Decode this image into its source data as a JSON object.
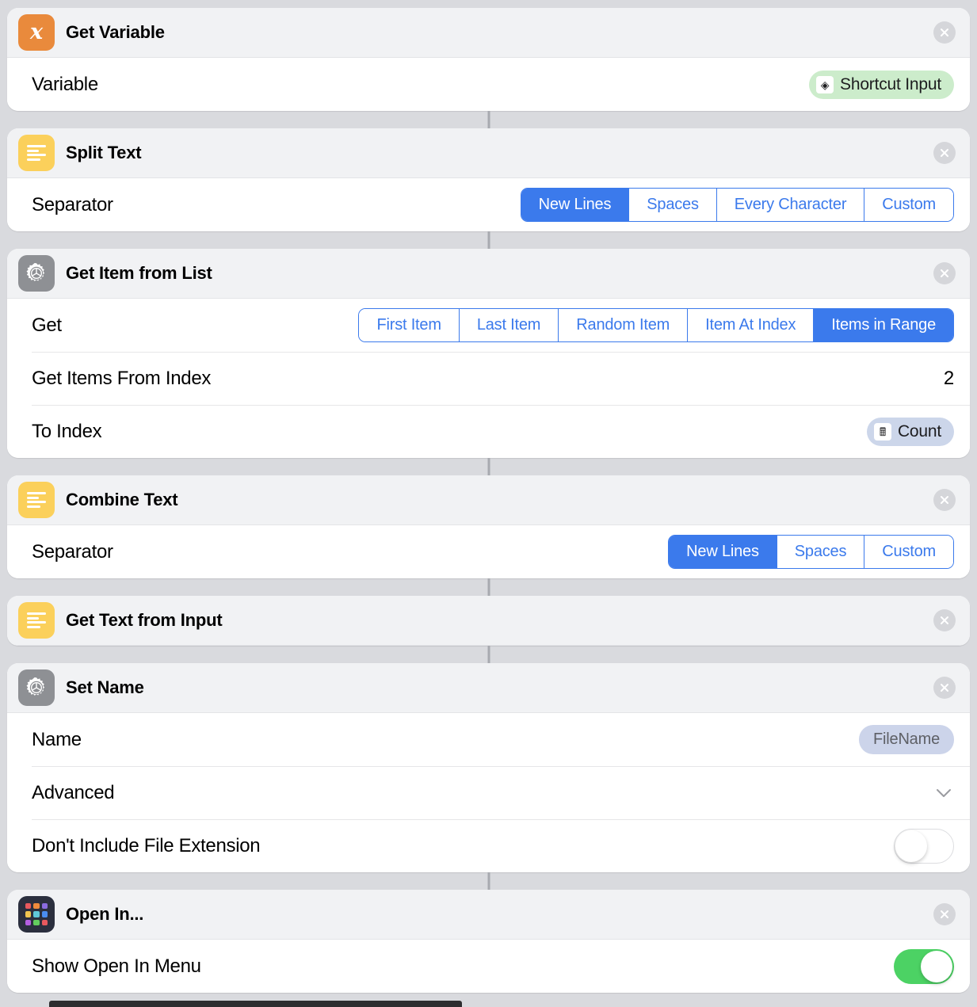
{
  "app": {
    "name": "Shortcuts Editor",
    "close_icon": "close-icon"
  },
  "colors": {
    "accent_blue": "#3b7aec",
    "icon_orange": "#e98a3c",
    "icon_yellow": "#fbd05b",
    "icon_gray": "#8e9094",
    "icon_grid_bg": "#2b2f3e",
    "toggle_on_green": "#4cd264",
    "token_green": "#cceccb",
    "token_blue": "#ccd6ea",
    "page_background": "#d9dade"
  },
  "actions": [
    {
      "id": "get-variable",
      "title": "Get Variable",
      "icon": "variable-x-icon",
      "icon_style": "orange",
      "rows": [
        {
          "type": "token",
          "label": "Variable",
          "token": {
            "text": "Shortcut Input",
            "style": "green",
            "icon": "shortcut-input-icon",
            "glyph": "◈"
          }
        }
      ]
    },
    {
      "id": "split-text",
      "title": "Split Text",
      "icon": "text-lines-icon",
      "icon_style": "yellow",
      "rows": [
        {
          "type": "segmented",
          "label": "Separator",
          "options": [
            "New Lines",
            "Spaces",
            "Every Character",
            "Custom"
          ],
          "selected": "New Lines"
        }
      ]
    },
    {
      "id": "get-item-from-list",
      "title": "Get Item from List",
      "icon": "gear-icon",
      "icon_style": "gray",
      "rows": [
        {
          "type": "segmented",
          "label": "Get",
          "options": [
            "First Item",
            "Last Item",
            "Random Item",
            "Item At Index",
            "Items in Range"
          ],
          "selected": "Items in Range"
        },
        {
          "type": "value",
          "label": "Get Items From Index",
          "value": "2"
        },
        {
          "type": "token",
          "label": "To Index",
          "token": {
            "text": "Count",
            "style": "blue",
            "icon": "calculator-icon",
            "glyph": "🖩"
          }
        }
      ]
    },
    {
      "id": "combine-text",
      "title": "Combine Text",
      "icon": "text-lines-icon",
      "icon_style": "yellow",
      "rows": [
        {
          "type": "segmented",
          "label": "Separator",
          "options": [
            "New Lines",
            "Spaces",
            "Custom"
          ],
          "selected": "New Lines"
        }
      ]
    },
    {
      "id": "get-text-from-input",
      "title": "Get Text from Input",
      "icon": "text-lines-icon",
      "icon_style": "yellow",
      "rows": []
    },
    {
      "id": "set-name",
      "title": "Set Name",
      "icon": "gear-icon",
      "icon_style": "gray",
      "rows": [
        {
          "type": "token",
          "label": "Name",
          "token": {
            "text": "FileName",
            "style": "plain"
          }
        },
        {
          "type": "disclosure",
          "label": "Advanced",
          "icon": "chevron-down-icon"
        },
        {
          "type": "toggle",
          "label": "Don't Include File Extension",
          "state": "off"
        }
      ]
    },
    {
      "id": "open-in",
      "title": "Open In...",
      "icon": "app-grid-icon",
      "icon_style": "grid",
      "rows": [
        {
          "type": "toggle",
          "label": "Show Open In Menu",
          "state": "on"
        }
      ]
    }
  ],
  "grid_icon_colors": [
    "#e8595e",
    "#ef8b3c",
    "#8b6ce0",
    "#f0c550",
    "#5fc9d8",
    "#4a8df0",
    "#b45fe0",
    "#63cc5e",
    "#e8595e"
  ]
}
